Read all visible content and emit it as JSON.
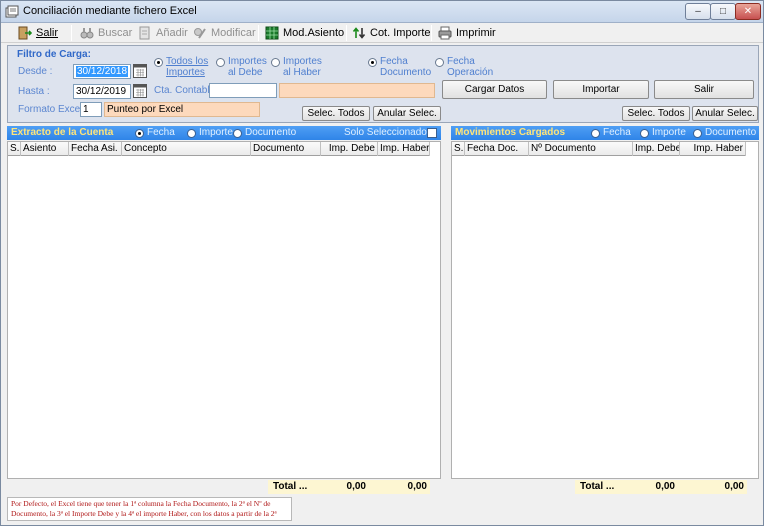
{
  "window": {
    "title": "Conciliación mediante fichero Excel",
    "min_label": "–",
    "max_label": "□",
    "close_label": "✕"
  },
  "toolbar": {
    "salir": "Salir",
    "buscar": "Buscar",
    "anadir": "Añadir",
    "modificar": "Modificar",
    "mod_asiento": "Mod.Asiento",
    "cot_importe": "Cot. Importe",
    "imprimir": "Imprimir"
  },
  "filter": {
    "title": "Filtro de Carga:",
    "desde_label": "Desde :",
    "desde_value": "30/12/2018",
    "hasta_label": "Hasta :",
    "hasta_value": "30/12/2019",
    "formato_label": "Formato Excel",
    "formato_value": "1",
    "formato_desc": "Punteo por Excel",
    "cta_label": "Cta. Contable",
    "cta_value": "",
    "cta_desc": "",
    "radio_todos": "Todos los Importes",
    "radio_debe": "Importes al Debe",
    "radio_haber": "Importes al Haber",
    "radio_fecha_doc": "Fecha Documento",
    "radio_fecha_op": "Fecha Operación",
    "cargar_datos": "Cargar Datos",
    "importar": "Importar",
    "salir": "Salir",
    "selec_todos_left": "Selec. Todos",
    "anular_left": "Anular Selec.",
    "selec_todos_right": "Selec. Todos",
    "anular_right": "Anular Selec."
  },
  "left_panel": {
    "title": "Extracto de la Cuenta",
    "opt_fecha": "Fecha",
    "opt_importe": "Importe",
    "opt_documento": "Documento",
    "solo_sel": "Solo Seleccionados",
    "columns": [
      "S.",
      "Asiento",
      "Fecha Asi.",
      "Concepto",
      "Documento",
      "Imp. Debe",
      "Imp. Haber"
    ],
    "total_label": "Total ...",
    "total_debe": "0,00",
    "total_haber": "0,00"
  },
  "right_panel": {
    "title": "Movimientos Cargados",
    "opt_fecha": "Fecha",
    "opt_importe": "Importe",
    "opt_documento": "Documento",
    "columns": [
      "S.",
      "Fecha Doc.",
      "Nº Documento",
      "Imp. Debe",
      "Imp. Haber"
    ],
    "total_label": "Total ...",
    "total_debe": "0,00",
    "total_haber": "0,00"
  },
  "note": "Por Defecto, el Excel tiene que tener la 1ª columna la Fecha Documento, la 2ª el Nº de Documento, la 3ª el Importe Debe y la 4ª el importe Haber, con los datos a partir de la 2ª fila."
}
